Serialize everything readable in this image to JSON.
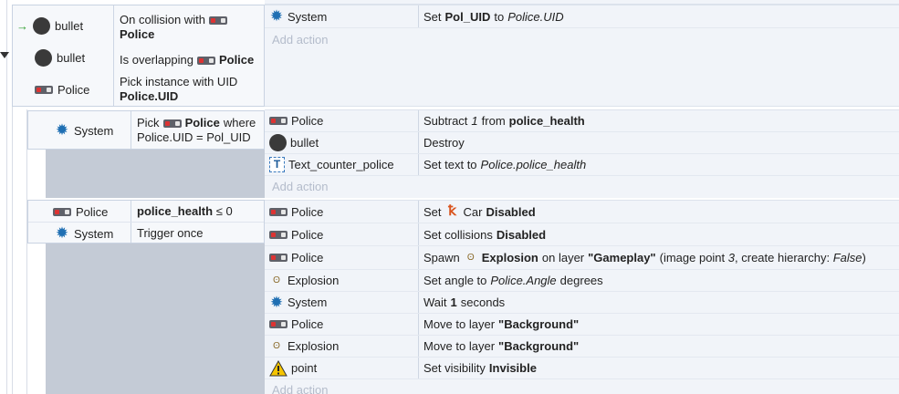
{
  "colors": {
    "accent": "#1f6fb3",
    "event_border": "#c9d3e2",
    "action_bg": "#f1f4f9",
    "gray_fill": "#c4cbd6",
    "add_action": "#b4bccb"
  },
  "event1": {
    "conditions": [
      {
        "object": "bullet",
        "icon": "black-circle-icon",
        "text_prefix": "On collision with",
        "text_target": "Police"
      },
      {
        "object": "bullet",
        "icon": "black-circle-icon",
        "text_prefix": "Is overlapping",
        "text_target": "Police"
      },
      {
        "object": "Police",
        "icon": "police-car-icon",
        "text_line1": "Pick instance with UID",
        "text_line2": "Police.UID"
      }
    ],
    "actions": [
      {
        "object": "System",
        "text_prefix": "Set",
        "var": "Pol_UID",
        "text_mid": "to",
        "value": "Police.UID"
      }
    ],
    "add_action": "Add action"
  },
  "event2": {
    "condition": {
      "object": "System",
      "text_pick": "Pick",
      "target": "Police",
      "text_where": "where",
      "expr": "Police.UID = Pol_UID"
    },
    "actions": [
      {
        "object": "Police",
        "text_prefix": "Subtract",
        "num": "1",
        "text_mid": "from",
        "var": "police_health"
      },
      {
        "object": "bullet",
        "text": "Destroy"
      },
      {
        "object": "Text_counter_police",
        "text_prefix": "Set text to",
        "value": "Police.police_health"
      }
    ],
    "add_action": "Add action"
  },
  "event3": {
    "conditions": [
      {
        "object": "Police",
        "var": "police_health",
        "op": "≤ 0"
      },
      {
        "object": "System",
        "text": "Trigger once"
      }
    ],
    "actions": [
      {
        "object": "Police",
        "text_prefix": "Set",
        "target": "Car",
        "state": "Disabled"
      },
      {
        "object": "Police",
        "text_prefix": "Set collisions",
        "state": "Disabled"
      },
      {
        "object": "Police",
        "text_prefix": "Spawn",
        "target": "Explosion",
        "text_mid": "on layer",
        "layer": "\"Gameplay\"",
        "text_open": "(image point",
        "point": "3",
        "text_hier": ", create hierarchy:",
        "hier": "False",
        "text_close": ")"
      },
      {
        "object": "Explosion",
        "text_prefix": "Set angle to",
        "value": "Police.Angle",
        "text_suffix": "degrees"
      },
      {
        "object": "System",
        "text_prefix": "Wait",
        "num": "1",
        "text_suffix": "seconds"
      },
      {
        "object": "Police",
        "text_prefix": "Move to layer",
        "layer": "\"Background\""
      },
      {
        "object": "Explosion",
        "text_prefix": "Move to layer",
        "layer": "\"Background\""
      },
      {
        "object": "point",
        "text_prefix": "Set visibility",
        "state": "Invisible"
      }
    ],
    "add_action": "Add action"
  }
}
